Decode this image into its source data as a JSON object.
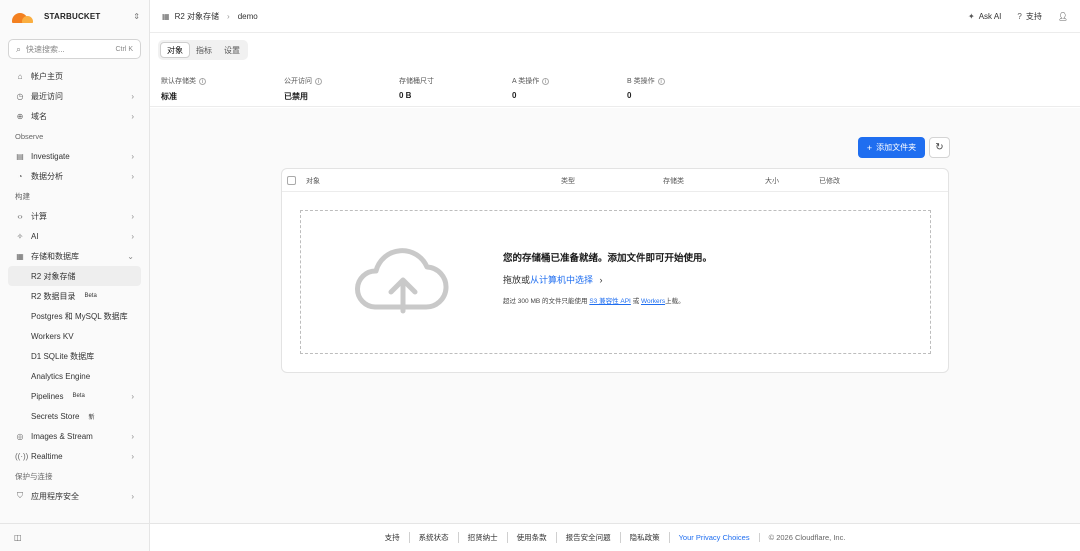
{
  "account": {
    "name": "STARBUCKET"
  },
  "search": {
    "placeholder": "快速搜索...",
    "shortcut": "Ctrl K"
  },
  "sidebar": {
    "top_items": [
      {
        "label": "帐户主页",
        "icon": "home-icon"
      },
      {
        "label": "最近访问",
        "icon": "clock-icon"
      },
      {
        "label": "域名",
        "icon": "globe-icon"
      }
    ],
    "sections": [
      {
        "label": "Observe"
      },
      {
        "label": "构建"
      },
      {
        "label": "保护与连接"
      }
    ],
    "observe_items": [
      {
        "label": "Investigate",
        "icon": "document-search-icon"
      },
      {
        "label": "数据分析",
        "icon": "pie-chart-icon"
      }
    ],
    "build_items": [
      {
        "label": "计算",
        "icon": "code-icon"
      },
      {
        "label": "AI",
        "icon": "sparkle-icon"
      },
      {
        "label": "存储和数据库",
        "icon": "database-icon"
      }
    ],
    "storage_sub": [
      {
        "label": "R2 对象存储",
        "badge": ""
      },
      {
        "label": "R2 数据目录",
        "badge": "Beta"
      },
      {
        "label": "Postgres 和 MySQL 数据库",
        "badge": ""
      },
      {
        "label": "Workers KV",
        "badge": ""
      },
      {
        "label": "D1 SQLite 数据库",
        "badge": ""
      },
      {
        "label": "Analytics Engine",
        "badge": ""
      },
      {
        "label": "Pipelines",
        "badge": "Beta"
      },
      {
        "label": "Secrets Store",
        "badge": "新"
      }
    ],
    "more_items": [
      {
        "label": "Images & Stream",
        "icon": "image-icon"
      },
      {
        "label": "Realtime",
        "icon": "broadcast-icon"
      }
    ],
    "security_items": [
      {
        "label": "应用程序安全",
        "icon": "shield-icon"
      }
    ]
  },
  "breadcrumb": {
    "parent": "R2 对象存储",
    "current": "demo"
  },
  "topbar": {
    "ask_ai": "Ask AI",
    "support": "支持"
  },
  "tabs": [
    {
      "label": "对象"
    },
    {
      "label": "指标"
    },
    {
      "label": "设置"
    }
  ],
  "stats": [
    {
      "label": "默认存储类",
      "value": "标准"
    },
    {
      "label": "公开访问",
      "value": "已禁用"
    },
    {
      "label": "存储桶尺寸",
      "value": "0 B"
    },
    {
      "label": "A 类操作",
      "value": "0"
    },
    {
      "label": "B 类操作",
      "value": "0"
    }
  ],
  "actions": {
    "add_folder": "添加文件夹"
  },
  "table": {
    "columns": [
      "对象",
      "类型",
      "存储类",
      "大小",
      "已修改"
    ]
  },
  "dropzone": {
    "title": "您的存储桶已准备就绪。添加文件即可开始使用。",
    "drag_text": "拖放或",
    "select_link": "从计算机中选择",
    "note_prefix": "超过 300 MB 的文件只能使用",
    "note_link1": "S3 兼容性 API",
    "note_or": "或",
    "note_link2": "Workers",
    "note_suffix": "上载。"
  },
  "footer": {
    "links": [
      "支持",
      "系统状态",
      "招贤纳士",
      "使用条款",
      "报告安全问题",
      "隐私政策"
    ],
    "privacy_choices": "Your Privacy Choices",
    "copyright": "© 2026 Cloudflare, Inc."
  },
  "colors": {
    "accent": "#1f6ef0",
    "brand_orange": "#f38020"
  }
}
